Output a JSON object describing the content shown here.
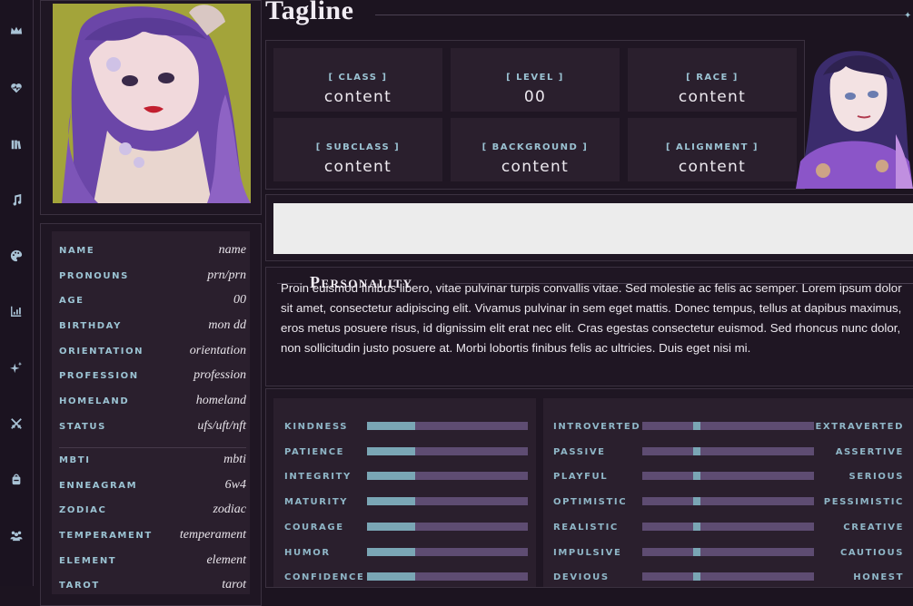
{
  "sidebar": {
    "icons": [
      "crown-icon",
      "heart-pulse-icon",
      "books-icon",
      "music-note-icon",
      "palette-icon",
      "chart-icon",
      "sparkles-icon",
      "crossed-swords-icon",
      "backpack-icon",
      "people-icon"
    ]
  },
  "profile": {
    "rows": [
      {
        "key": "NAME",
        "value": "name"
      },
      {
        "key": "PRONOUNS",
        "value": "prn/prn"
      },
      {
        "key": "AGE",
        "value": "00"
      },
      {
        "key": "BIRTHDAY",
        "value": "mon dd"
      },
      {
        "key": "ORIENTATION",
        "value": "orientation"
      },
      {
        "key": "PROFESSION",
        "value": "profession"
      },
      {
        "key": "HOMELAND",
        "value": "homeland"
      },
      {
        "key": "STATUS",
        "value": "ufs/uft/nft"
      },
      {
        "key": "MBTI",
        "value": "mbti"
      },
      {
        "key": "ENNEAGRAM",
        "value": "6w4"
      },
      {
        "key": "ZODIAC",
        "value": "zodiac"
      },
      {
        "key": "TEMPERAMENT",
        "value": "temperament"
      },
      {
        "key": "ELEMENT",
        "value": "element"
      },
      {
        "key": "TAROT",
        "value": "tarot"
      }
    ]
  },
  "header": {
    "tagline": "Tagline"
  },
  "stats": [
    {
      "label": "[ CLASS ]",
      "value": "content"
    },
    {
      "label": "[ LEVEL ]",
      "value": "00"
    },
    {
      "label": "[ RACE ]",
      "value": "content"
    },
    {
      "label": "[ SUBCLASS ]",
      "value": "content"
    },
    {
      "label": "[ BACKGROUND ]",
      "value": "content"
    },
    {
      "label": "[ ALIGNMENT ]",
      "value": "content"
    }
  ],
  "personality": {
    "title": "Personality",
    "text": "Proin euismod finibus libero, vitae pulvinar turpis convallis vitae. Sed molestie ac felis ac semper. Lorem ipsum dolor sit amet, consectetur adipiscing elit. Vivamus pulvinar in sem eget mattis. Donec tempus, tellus at dapibus maximus, eros metus posuere risus, id dignissim elit erat nec elit. Cras egestas consectetur euismod. Sed rhoncus nunc dolor, non sollicitudin justo posuere at. Morbi lobortis finibus felis ac ultricies. Duis eget nisi mi."
  },
  "traits_left": [
    {
      "label": "KINDNESS",
      "level": 0.3
    },
    {
      "label": "PATIENCE",
      "level": 0.3
    },
    {
      "label": "INTEGRITY",
      "level": 0.3
    },
    {
      "label": "MATURITY",
      "level": 0.3
    },
    {
      "label": "COURAGE",
      "level": 0.3
    },
    {
      "label": "HUMOR",
      "level": 0.3
    },
    {
      "label": "CONFIDENCE",
      "level": 0.3
    }
  ],
  "traits_right": [
    {
      "left": "INTROVERTED",
      "right": "EXTRAVERTED",
      "level": 0.32
    },
    {
      "left": "PASSIVE",
      "right": "ASSERTIVE",
      "level": 0.32
    },
    {
      "left": "PLAYFUL",
      "right": "SERIOUS",
      "level": 0.32
    },
    {
      "left": "OPTIMISTIC",
      "right": "PESSIMISTIC",
      "level": 0.32
    },
    {
      "left": "REALISTIC",
      "right": "CREATIVE",
      "level": 0.32
    },
    {
      "left": "IMPULSIVE",
      "right": "CAUTIOUS",
      "level": 0.32
    },
    {
      "left": "DEVIOUS",
      "right": "HONEST",
      "level": 0.32
    }
  ],
  "colors": {
    "accent": "#9bc3d3",
    "bar": "#5e4c72",
    "fill": "#7aa6b5",
    "panel": "#2a1f2d",
    "bg": "#1c1420"
  }
}
